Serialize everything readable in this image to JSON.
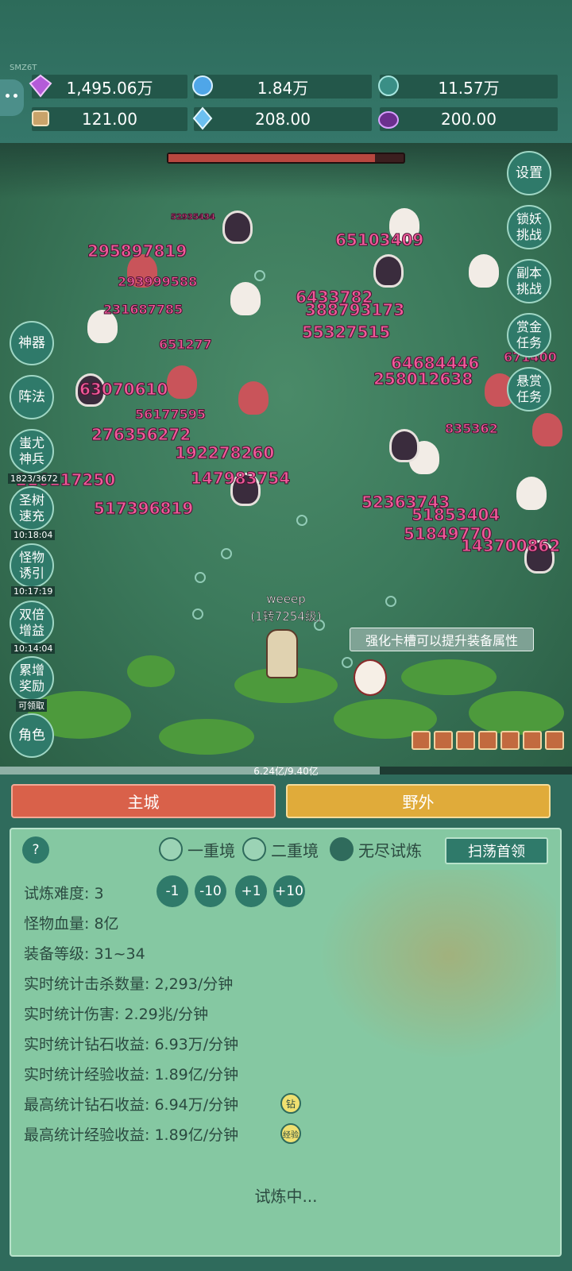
{
  "version": "SMZ6T",
  "currencies": [
    {
      "icon": "purple-gem-icon",
      "value": "1,495.06万"
    },
    {
      "icon": "blue-crystal-icon",
      "value": "1.84万"
    },
    {
      "icon": "green-orb-icon",
      "value": "11.57万"
    },
    {
      "icon": "scroll-icon",
      "value": "121.00"
    },
    {
      "icon": "ice-shard-icon",
      "value": "208.00"
    },
    {
      "icon": "purple-pot-icon",
      "value": "200.00"
    }
  ],
  "right_buttons": [
    "设置",
    "锁妖挑战",
    "副本挑战",
    "赏金任务",
    "悬赏任务"
  ],
  "left_buttons": [
    {
      "label": "神器",
      "timer": ""
    },
    {
      "label": "阵法",
      "timer": ""
    },
    {
      "label": "蚩尤神兵",
      "timer": "1823/3672"
    },
    {
      "label": "圣树速充",
      "timer": "10:18:04"
    },
    {
      "label": "怪物诱引",
      "timer": "10:17:19"
    },
    {
      "label": "双倍增益",
      "timer": "10:14:04"
    },
    {
      "label": "累增奖励",
      "timer": "可领取"
    },
    {
      "label": "角色",
      "timer": ""
    }
  ],
  "damage_numbers": [
    "295897819",
    "293999588",
    "231687785",
    "651277",
    "63070610",
    "56177595",
    "276356272",
    "192278260",
    "147983754",
    "216117250",
    "517396819",
    "6433782",
    "388793173",
    "55327515",
    "64684446",
    "258012638",
    "65103409",
    "52363743",
    "51853404",
    "51849770",
    "143700862",
    "52935434",
    "835362",
    "671400"
  ],
  "player": {
    "name": "weeep",
    "level": "(1转7254级)"
  },
  "tip": "强化卡槽可以提升装备属性",
  "exp_text": "6.24亿/9.40亿",
  "exp_fraction": 0.664,
  "tabs": {
    "city": "主城",
    "wild": "野外"
  },
  "help": "?",
  "modes": [
    "一重境",
    "二重境",
    "无尽试炼"
  ],
  "sweep_button": "扫荡首领",
  "adjust_buttons": [
    "-1",
    "-10",
    "+1",
    "+10"
  ],
  "stats": [
    "试炼难度: 3",
    "怪物血量: 8亿",
    "装备等级: 31~34",
    "实时统计击杀数量: 2,293/分钟",
    "实时统计伤害: 2.29兆/分钟",
    "实时统计钻石收益: 6.93万/分钟",
    "实时统计经验收益: 1.89亿/分钟",
    "最高统计钻石收益: 6.94万/分钟",
    "最高统计经验收益: 1.89亿/分钟"
  ],
  "badges": [
    "钻",
    "经验"
  ],
  "status": "试炼中...",
  "colors": {
    "city_tab": "#d9614a",
    "wild_tab": "#e0ab3a",
    "panel": "#85c8a2",
    "damage": "#f05a9a"
  }
}
